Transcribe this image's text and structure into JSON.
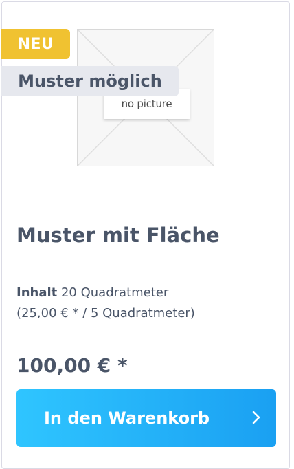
{
  "product": {
    "badges": {
      "new": "NEU",
      "sample": "Muster möglich"
    },
    "image": {
      "placeholder_text": "no picture"
    },
    "title": "Muster mit Fläche",
    "content": {
      "label": "Inhalt",
      "value": "20 Quadratmeter",
      "unit_price": "(25,00 € * / 5 Quadratmeter)"
    },
    "price": "100,00 € *",
    "cart_button": {
      "label": "In den Warenkorb",
      "icon": "chevron-right-icon"
    }
  },
  "colors": {
    "badge_new": "#f0c231",
    "badge_sample": "#e6e8ee",
    "text": "#4a5568",
    "button_start": "#2fc5ff",
    "button_end": "#1aa0f2"
  }
}
